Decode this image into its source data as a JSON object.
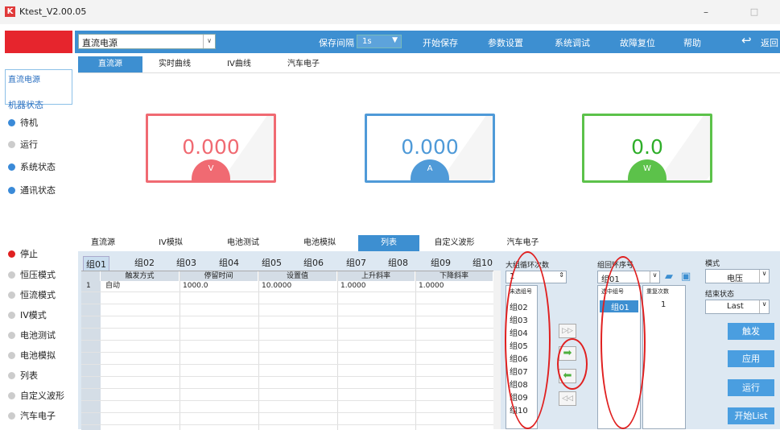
{
  "window": {
    "logo": "K",
    "title": "Ktest_V2.00.05",
    "minimize": "–",
    "maximize": "□"
  },
  "topbar": {
    "source_value": "直流电源",
    "save_interval_label": "保存间隔",
    "save_interval_value": "1s",
    "start_save": "开始保存",
    "param_settings": "参数设置",
    "system_debug": "系统调试",
    "fault_reset": "故障复位",
    "help": "帮助",
    "back": "返回"
  },
  "sidebar": {
    "input_value": "直流电源",
    "status_title": "机器状态",
    "status_items": [
      {
        "label": "待机",
        "color": "#3a8ad8"
      },
      {
        "label": "运行",
        "color": "#cccccc"
      },
      {
        "label": "系统状态",
        "color": "#3a8ad8"
      },
      {
        "label": "通讯状态",
        "color": "#3a8ad8"
      }
    ],
    "mode_items": [
      {
        "label": "停止",
        "color": "#e02020"
      },
      {
        "label": "恒压模式",
        "color": "#cccccc"
      },
      {
        "label": "恒流模式",
        "color": "#cccccc"
      },
      {
        "label": "IV模式",
        "color": "#cccccc"
      },
      {
        "label": "电池测试",
        "color": "#cccccc"
      },
      {
        "label": "电池模拟",
        "color": "#cccccc"
      },
      {
        "label": "列表",
        "color": "#cccccc"
      },
      {
        "label": "自定义波形",
        "color": "#cccccc"
      },
      {
        "label": "汽车电子",
        "color": "#cccccc"
      }
    ]
  },
  "main_tabs": [
    "直流源",
    "实时曲线",
    "IV曲线",
    "汽车电子"
  ],
  "gauges": [
    {
      "value": "0.000",
      "unit": "V",
      "color": "#f06a72"
    },
    {
      "value": "0.000",
      "unit": "A",
      "color": "#4f9ad8"
    },
    {
      "value": "0.0",
      "unit": "W",
      "color": "#5cc24a"
    }
  ],
  "lower_tabs": [
    "直流源",
    "IV模拟",
    "电池测试",
    "电池模拟",
    "列表",
    "自定义波形",
    "汽车电子"
  ],
  "group_tabs": [
    "组01",
    "组02",
    "组03",
    "组04",
    "组05",
    "组06",
    "组07",
    "组08",
    "组09",
    "组10"
  ],
  "table": {
    "headers": [
      "触发方式",
      "停留时间",
      "设置值",
      "上升斜率",
      "下降斜率"
    ],
    "rows": [
      {
        "num": "1",
        "trigger": "自动",
        "dwell": "1000.0",
        "setpoint": "10.0000",
        "rise": "1.0000",
        "fall": "1.0000"
      }
    ]
  },
  "right": {
    "loop_label": "大组循环次数",
    "loop_value": "1",
    "unselected_label": "未选组号",
    "unselected": [
      "组02",
      "组03",
      "组04",
      "组05",
      "组06",
      "组07",
      "组08",
      "组09",
      "组10"
    ],
    "order_label": "组回环序号",
    "order_value": "组01",
    "selected_label": "选中组号",
    "repeat_label": "重复次数",
    "selected_group": "组01",
    "selected_repeat": "1",
    "mode_label": "模式",
    "mode_value": "电压",
    "end_label": "结束状态",
    "end_value": "Last",
    "btn_trigger": "触发",
    "btn_apply": "应用",
    "btn_run": "运行",
    "btn_start_list": "开始List"
  }
}
